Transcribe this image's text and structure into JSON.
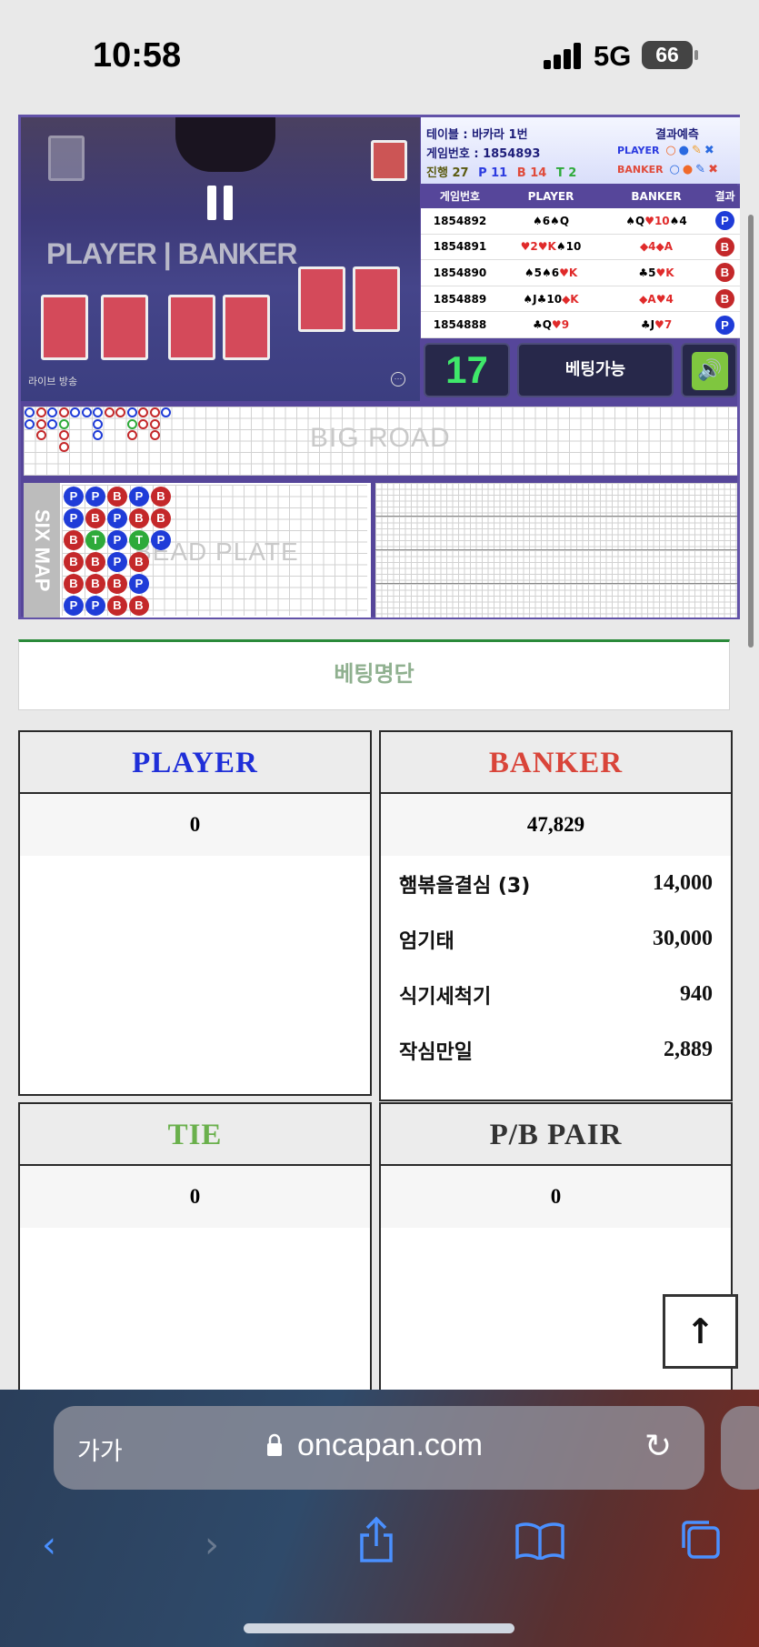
{
  "status_bar": {
    "time": "10:58",
    "network": "5G",
    "battery": "66"
  },
  "video": {
    "live_label": "라이브 방송",
    "table_print": "PLAYER | BANKER"
  },
  "table_info": {
    "table_line": "테이블 : 바카라 1번",
    "game_no_line": "게임번호 : 1854893",
    "progress_label": "진행 27",
    "progress_p": "P 11",
    "progress_b": "B 14",
    "progress_t": "T 2",
    "prediction_label": "결과예측",
    "player_label": "PLAYER",
    "banker_label": "BANKER"
  },
  "results_table": {
    "headers": [
      "게임번호",
      "PLAYER",
      "BANKER",
      "결과"
    ],
    "rows": [
      {
        "no": "1854892",
        "player": "♠6♠Q",
        "banker": "♠Q♥10♠4",
        "result": "P"
      },
      {
        "no": "1854891",
        "player": "♥2♥K♠10",
        "banker": "◆4◆A",
        "result": "B"
      },
      {
        "no": "1854890",
        "player": "♠5♠6♥K",
        "banker": "♣5♥K",
        "result": "B"
      },
      {
        "no": "1854889",
        "player": "♠J♣10◆K",
        "banker": "◆A♥4",
        "result": "B"
      },
      {
        "no": "1854888",
        "player": "♣Q♥9",
        "banker": "♣J♥7",
        "result": "P"
      }
    ]
  },
  "countdown": "17",
  "betting_status": "베팅가능",
  "roads": {
    "big_road_label": "BIG ROAD",
    "six_map_label": "SIX MAP",
    "bead_plate_label": "BEAD PLATE",
    "bead_plate": [
      [
        "P",
        "P",
        "B",
        "P",
        "B"
      ],
      [
        "P",
        "B",
        "P",
        "B",
        "B"
      ],
      [
        "B",
        "T",
        "P",
        "T",
        "P"
      ],
      [
        "B",
        "B",
        "P",
        "B"
      ],
      [
        "B",
        "B",
        "B",
        "P"
      ],
      [
        "P",
        "P",
        "B",
        "B"
      ]
    ]
  },
  "betting_list_title": "베팅명단",
  "panels": {
    "player": {
      "title": "PLAYER",
      "total": "0",
      "color": "#1f2fd8"
    },
    "banker": {
      "title": "BANKER",
      "total": "47,829",
      "color": "#d9453a",
      "bets": [
        {
          "name": "햄볶을결심 (3)",
          "amount": "14,000"
        },
        {
          "name": "엄기태",
          "amount": "30,000"
        },
        {
          "name": "식기세척기",
          "amount": "940"
        },
        {
          "name": "작심만일",
          "amount": "2,889"
        }
      ]
    },
    "tie": {
      "title": "TIE",
      "total": "0",
      "color": "#6ab04c"
    },
    "pair": {
      "title": "P/B PAIR",
      "total": "0",
      "color": "#333333"
    }
  },
  "browser": {
    "text_size": "가가",
    "url": "oncapan.com"
  }
}
